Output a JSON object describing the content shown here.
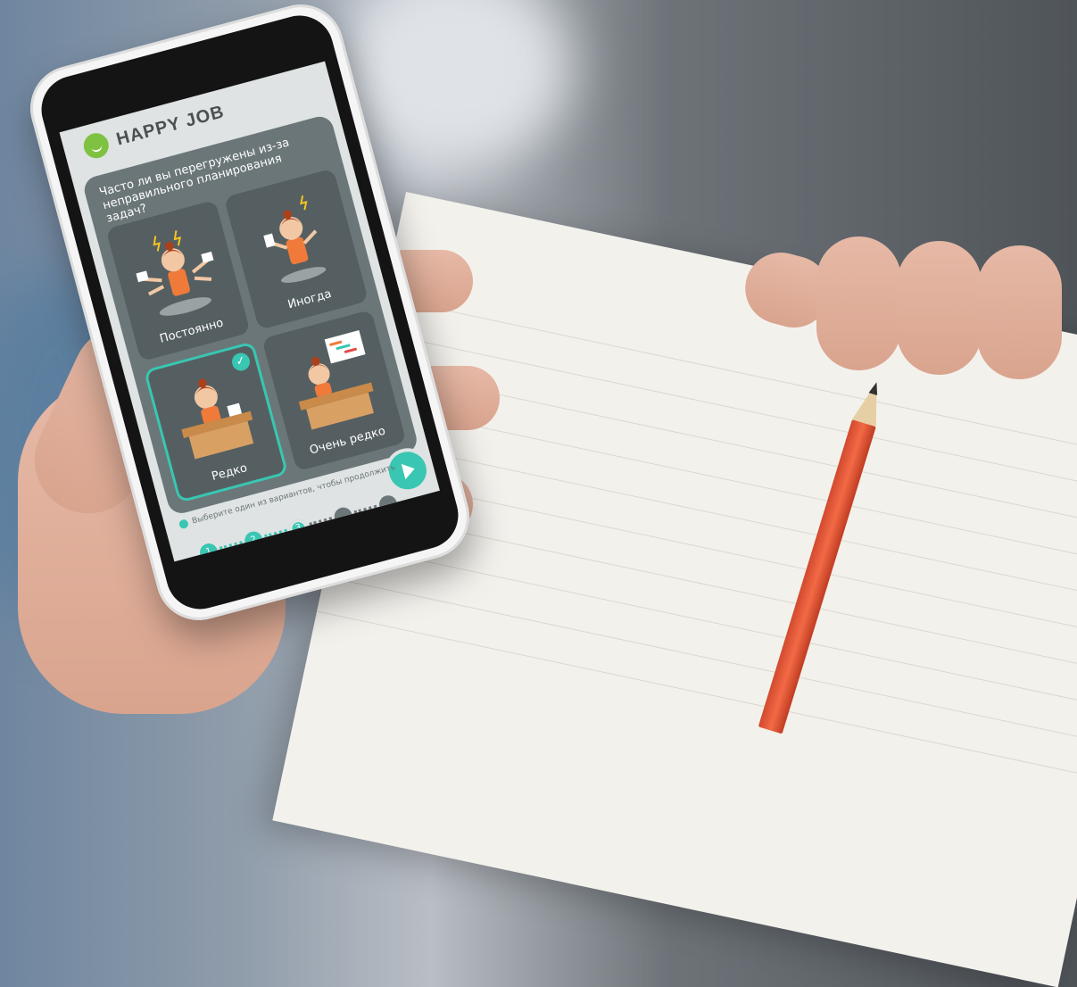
{
  "app": {
    "brand": "HAPPY JOB",
    "question": "Часто ли вы перегружены из-за неправильного планирования задач?",
    "options": [
      {
        "label": "Постоянно",
        "selected": false
      },
      {
        "label": "Иногда",
        "selected": false
      },
      {
        "label": "Редко",
        "selected": true
      },
      {
        "label": "Очень редко",
        "selected": false
      }
    ],
    "hint": "Выберите один из вариантов, чтобы продолжить",
    "progress": {
      "current_step": 3,
      "total_steps": 5,
      "steps": [
        "1",
        "2",
        "3",
        "",
        ""
      ]
    },
    "check_mark": "✓",
    "colors": {
      "accent": "#39c6b2",
      "panel": "#6b7678",
      "card": "#555f61",
      "logo": "#7fc242"
    },
    "icons": [
      "smile-logo-icon",
      "check-icon",
      "next-arrow-icon"
    ]
  }
}
